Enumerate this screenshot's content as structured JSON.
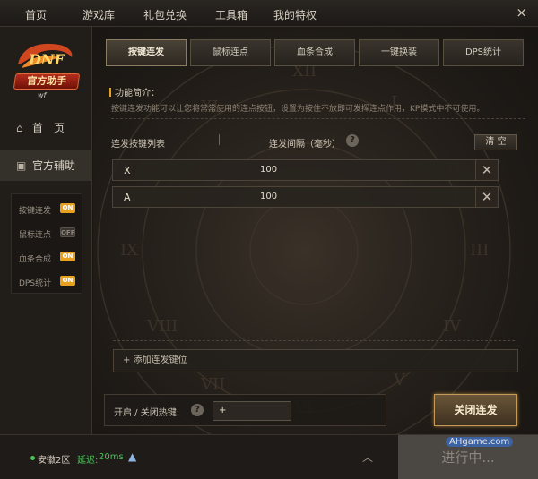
{
  "topnav": {
    "items": [
      "首页",
      "游戏库",
      "礼包兑换",
      "工具箱",
      "我的特权"
    ],
    "close_icon": "×"
  },
  "sidebar": {
    "logo": {
      "badge": "官方助手",
      "signature": "wf"
    },
    "nav": [
      {
        "label": "首　页",
        "icon": "home-icon"
      },
      {
        "label": "官方辅助",
        "icon": "briefcase-icon"
      }
    ],
    "sub_items": [
      {
        "label": "按键连发",
        "state": "ON"
      },
      {
        "label": "鼠标连点",
        "state": "OFF"
      },
      {
        "label": "血条合成",
        "state": "ON"
      },
      {
        "label": "DPS统计",
        "state": "ON"
      }
    ]
  },
  "tabs": [
    "按键连发",
    "鼠标连点",
    "血条合成",
    "一键换装",
    "DPS统计"
  ],
  "feature": {
    "title": "功能简介：",
    "description": "按键连发功能可以让您将常常使用的连点按钮，设置为按住不放即可发挥连点作用，KP模式中不可使用。"
  },
  "list": {
    "col_keys": "连发按键列表",
    "col_interval": "连发间隔（毫秒）",
    "help_icon": "?",
    "clear_label": "清 空",
    "rows": [
      {
        "key": "X",
        "interval": "100"
      },
      {
        "key": "A",
        "interval": "100"
      }
    ],
    "delete_icon": "✕",
    "add_label": "+ 添加连发键位"
  },
  "hotkey": {
    "label": "开启 / 关闭热键:",
    "help_icon": "?",
    "value": "+"
  },
  "action": {
    "close_label": "关闭连发"
  },
  "status": {
    "server": "安徽2区",
    "ping_label": "延迟:",
    "ping_value": "20ms",
    "rocket_icon": "▲",
    "chevron_icon": "︿",
    "running_label": "进行中..."
  },
  "watermark": "AHgame.com"
}
